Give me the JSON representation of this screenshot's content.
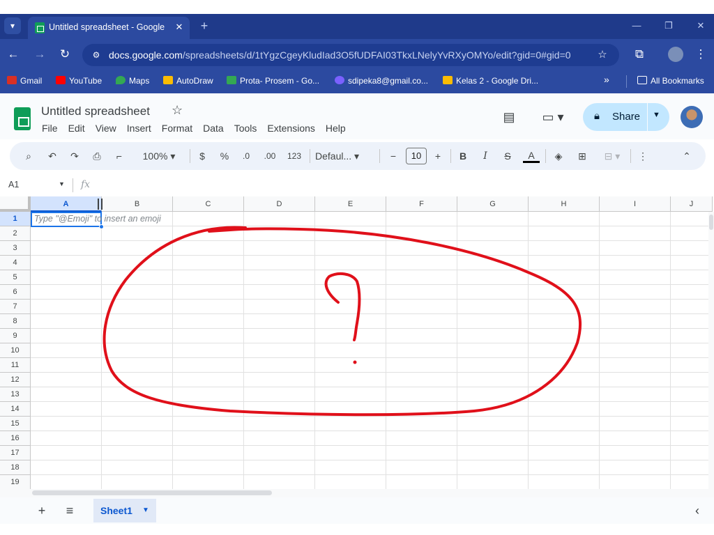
{
  "browser": {
    "tab_title": "Untitled spreadsheet - Google",
    "url_domain": "docs.google.com",
    "url_path": "/spreadsheets/d/1tYgzCgeyKludIad3O5fUDFAI03TkxLNelyYvRXyOMYo/edit?gid=0#gid=0",
    "bookmarks": [
      {
        "label": "Gmail",
        "color": "#d93025"
      },
      {
        "label": "YouTube",
        "color": "#ff0000"
      },
      {
        "label": "Maps",
        "color": "#34a853"
      },
      {
        "label": "AutoDraw",
        "color": "#fbbc04"
      },
      {
        "label": "Prota- Prosem - Go...",
        "color": "#34a853"
      },
      {
        "label": "sdipeka8@gmail.co...",
        "color": "#7b61ff"
      },
      {
        "label": "Kelas 2 - Google Dri...",
        "color": "#fbbc04"
      }
    ],
    "more_bookmarks": "»",
    "all_bookmarks": "All Bookmarks"
  },
  "app": {
    "doc_title": "Untitled spreadsheet",
    "menu": [
      "File",
      "Edit",
      "View",
      "Insert",
      "Format",
      "Data",
      "Tools",
      "Extensions",
      "Help"
    ],
    "share_label": "Share",
    "accent_color": "#c2e7ff",
    "brand_color": "#0f9d58"
  },
  "toolbar": {
    "zoom": "100%",
    "currency": "$",
    "percent": "%",
    "decrease_decimal": ".0",
    "increase_decimal": ".00",
    "number_format": "123",
    "font": "Defaul...",
    "font_size": "10",
    "bold": "B",
    "italic": "I",
    "strikethrough": "S",
    "text_color": "A"
  },
  "formula_bar": {
    "cell_ref": "A1",
    "fx": "fx"
  },
  "grid": {
    "columns": [
      "A",
      "B",
      "C",
      "D",
      "E",
      "F",
      "G",
      "H",
      "I",
      "J"
    ],
    "rows": [
      "1",
      "2",
      "3",
      "4",
      "5",
      "6",
      "7",
      "8",
      "9",
      "10",
      "11",
      "12",
      "13",
      "14",
      "15",
      "16",
      "17",
      "18",
      "19"
    ],
    "selected_cell": "A1",
    "cell_hint": "Type \"@Emoji\" to insert an emoji",
    "annotation_color": "#e0101a"
  },
  "sheets": {
    "tabs": [
      "Sheet1"
    ],
    "active": "Sheet1"
  }
}
